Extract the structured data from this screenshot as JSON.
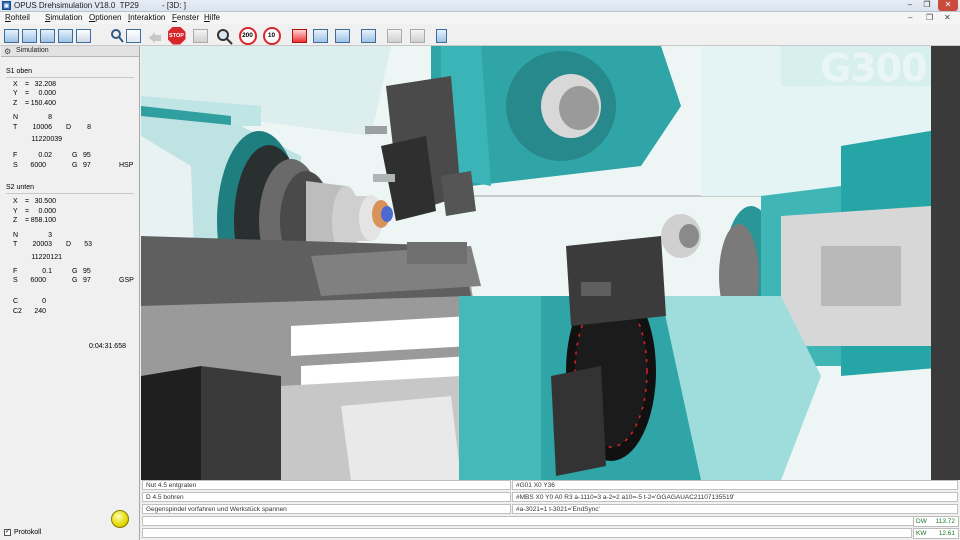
{
  "titlebar": {
    "app_title": "OPUS Drehsimulation V18.0  TP29",
    "document": "- [3D: ]",
    "minimize": "–",
    "restore": "❐",
    "close": "✕"
  },
  "menu": {
    "items": [
      {
        "accel": "R",
        "rest": "ohteil"
      },
      {
        "accel": "S",
        "rest": "imulation"
      },
      {
        "accel": "O",
        "rest": "ptionen"
      },
      {
        "accel": "I",
        "rest": "nteraktion"
      },
      {
        "accel": "F",
        "rest": "enster"
      },
      {
        "accel": "H",
        "rest": "ilfe"
      }
    ],
    "doc_controls": {
      "minimize": "–",
      "restore": "❐",
      "close": "✕"
    }
  },
  "toolbar": {
    "stop_label": "STOP",
    "speed_200": "200",
    "speed_10": "10"
  },
  "left_panel": {
    "tab_label": "Simulation",
    "s1": {
      "title": "S1 oben",
      "x": "32.208",
      "y": "0.000",
      "z": "150.400",
      "n": "8",
      "t": "10006",
      "d": "8",
      "tool_id": "11220039",
      "f": "0.02",
      "g1": "95",
      "s": "6000",
      "g2": "97",
      "spindle": "HSP"
    },
    "s2": {
      "title": "S2 unten",
      "x": "30.500",
      "y": "0.000",
      "z": "858.100",
      "n": "3",
      "t": "20003",
      "d": "53",
      "tool_id": "11220121",
      "f": "0.1",
      "g1": "95",
      "s": "6000",
      "g2": "97",
      "spindle": "GSP",
      "c": "0",
      "c2": "240"
    },
    "time": "0:04:31.658",
    "protokoll_label": "Protokoll",
    "protokoll_checked": "✓"
  },
  "viewport": {
    "overlay_text": "G300",
    "colors": {
      "teal": "#1e9ea0",
      "light_teal": "#aee8e8",
      "dark": "#2b2b2b",
      "white": "#f4f8f8"
    }
  },
  "log": [
    {
      "left": "Nut 4.5 entgraten",
      "right": "#G01 X0 Y36"
    },
    {
      "left": "D 4.5 bohren",
      "right": "#MBS X0 Y0 A0 R3 a-1110=3 a-2=2 a10=-5 t-2='GGAGAUAC21107135519'"
    },
    {
      "left": "Gegenspindel vorfahren und Werkstück spannen",
      "right": "#a-3021=1 t-3021='EndSync'"
    },
    {
      "left": "",
      "right": ""
    }
  ],
  "readouts": [
    {
      "key": "DW",
      "value": "113.72"
    },
    {
      "key": "KW",
      "value": "12.61"
    }
  ]
}
